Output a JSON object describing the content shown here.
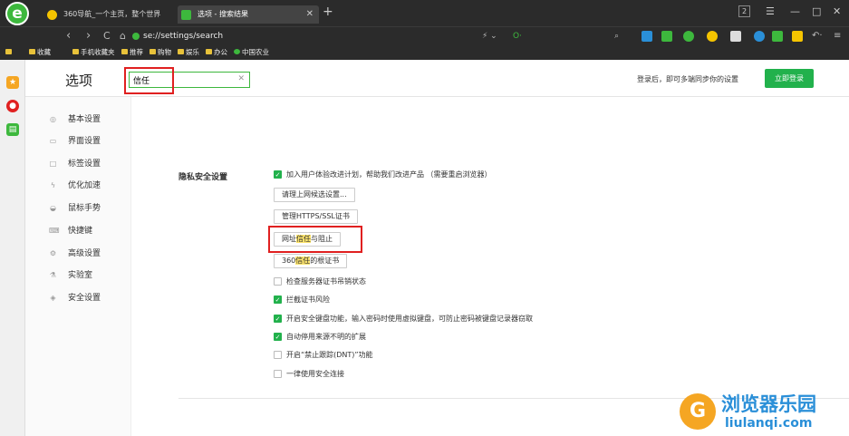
{
  "window": {
    "tabs": [
      {
        "title": "360导航_一个主页，整个世界",
        "active": false
      },
      {
        "title": "选项 - 搜索结果",
        "active": true
      }
    ],
    "new_tab": "+",
    "controls": {
      "badge": "2",
      "minimize": "—",
      "maximize": "□",
      "close": "✕"
    }
  },
  "nav": {
    "back": "‹",
    "forward": "›",
    "reload": "C",
    "home": "⌂",
    "address": "se://settings/search"
  },
  "bookmarks": {
    "toggle": "ᐊ",
    "items": [
      "收藏",
      "手机收藏夹",
      "推荐",
      "购物",
      "娱乐",
      "办公",
      "中国农业"
    ]
  },
  "settings": {
    "page_title": "选项",
    "search": {
      "value": "信任",
      "placeholder": "",
      "clear": "✕"
    },
    "login_hint": "登录后，即可多端同步你的设置",
    "login_button": "立即登录",
    "nav_items": [
      "基本设置",
      "界面设置",
      "标签设置",
      "优化加速",
      "鼠标手势",
      "快捷键",
      "高级设置",
      "实验室",
      "安全设置"
    ],
    "section_title": "隐私安全设置",
    "options": [
      {
        "label": "加入用户体验改进计划，帮助我们改进产品 （需要重启浏览器）",
        "checked": true
      },
      {
        "label": "检查服务器证书吊销状态",
        "checked": false
      },
      {
        "label": "拦截证书风险",
        "checked": true
      },
      {
        "label": "开启安全键盘功能，输入密码时使用虚拟键盘，可防止密码被键盘记录器窃取",
        "checked": true
      },
      {
        "label": "自动停用来源不明的扩展",
        "checked": true
      },
      {
        "label": "开启“禁止跟踪(DNT)”功能",
        "checked": false
      },
      {
        "label": "一律使用安全连接",
        "checked": false
      }
    ],
    "buttons": {
      "proxy": "请理上网候选设置...",
      "https": "管理HTTPS/SSL证书",
      "url_trust_pre": "网址",
      "url_trust_hl": "信任",
      "url_trust_post": "与阻止",
      "root_pre": "360",
      "root_hl": "信任",
      "root_post": "的根证书"
    }
  },
  "watermark": {
    "cn": "浏览器乐园",
    "en": "liulanqi.com"
  },
  "colors": {
    "accent": "#22b14c",
    "highlight_box": "#e02020",
    "chrome": "#2b2b2b"
  }
}
